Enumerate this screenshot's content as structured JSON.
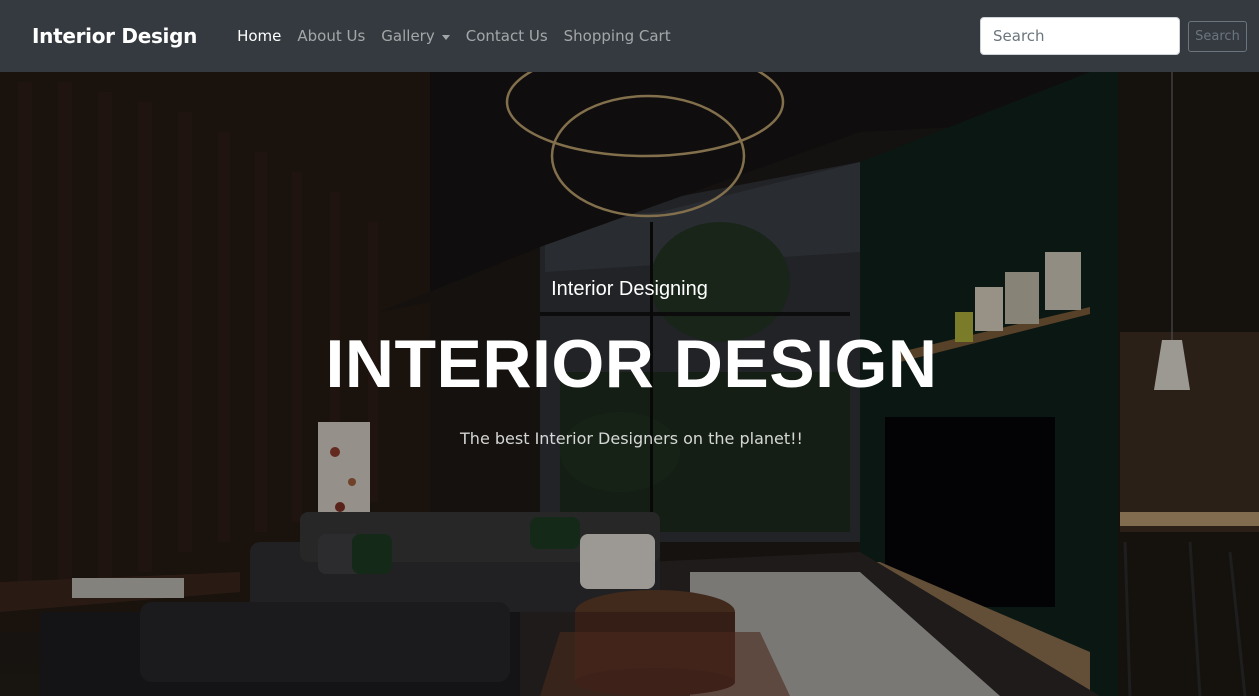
{
  "navbar": {
    "brand": "Interior Design",
    "links": [
      {
        "label": "Home",
        "active": true
      },
      {
        "label": "About Us",
        "active": false
      },
      {
        "label": "Gallery",
        "active": false,
        "dropdown": true
      },
      {
        "label": "Contact Us",
        "active": false
      },
      {
        "label": "Shopping Cart",
        "active": false
      }
    ],
    "search": {
      "placeholder": "Search",
      "value": "",
      "button_label": "Search"
    }
  },
  "hero": {
    "subtitle": "Interior Designing",
    "title": "INTERIOR DESIGN",
    "tagline": "The best Interior Designers on the planet!!",
    "background_description_icon": "living-room-photo"
  },
  "colors": {
    "navbar_bg": "#343a40",
    "nav_active": "#ffffff",
    "nav_inactive": "rgba(255,255,255,0.55)",
    "search_button_border": "#6c757d"
  }
}
